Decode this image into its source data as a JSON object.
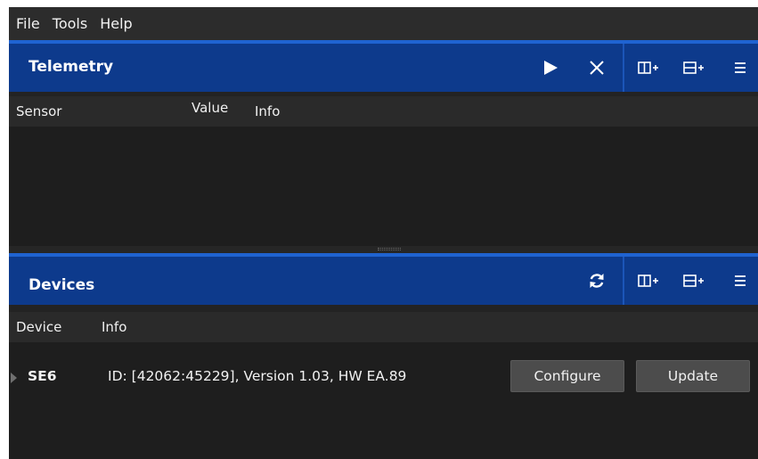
{
  "menu": [
    "File",
    "Tools",
    "Help"
  ],
  "telemetry": {
    "title": "Telemetry",
    "columns": {
      "sensor": "Sensor",
      "value": "Value",
      "info": "Info"
    }
  },
  "devices": {
    "title": "Devices",
    "columns": {
      "device": "Device",
      "info": "Info"
    },
    "rows": [
      {
        "name": "SE6",
        "info": "ID: [42062:45229], Version  1.03, HW EA.89",
        "configure_label": "Configure",
        "update_label": "Update"
      }
    ]
  },
  "icons": {
    "play": "play-icon",
    "close": "close-icon",
    "split_horizontal": "split-horizontal-icon",
    "split_vertical": "split-vertical-icon",
    "menu": "hamburger-menu-icon",
    "refresh": "refresh-icon"
  },
  "colors": {
    "titlebar": "#0d3a8c",
    "titlebar_accent": "#1f63d1",
    "background": "#232323",
    "button": "#4c4c4c"
  }
}
